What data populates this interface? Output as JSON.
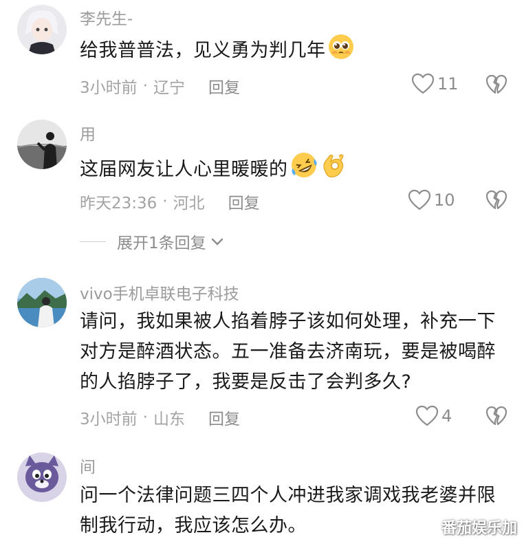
{
  "comments": [
    {
      "username": "李先生-",
      "text": "给我普普法，见义勇为判几年",
      "emoji": [
        "pleading-face-icon"
      ],
      "time": "3小时前",
      "separator": "·",
      "location": "辽宁",
      "reply_label": "回复",
      "likes": "11",
      "avatar": "anime-girl-avatar"
    },
    {
      "username": "用",
      "text": "这届网友让人心里暖暖的",
      "emoji": [
        "rolling-laughing-icon",
        "ok-hand-icon"
      ],
      "time": "昨天23:36",
      "separator": "·",
      "location": "河北",
      "reply_label": "回复",
      "likes": "10",
      "avatar": "silhouette-sunset-avatar"
    },
    {
      "username": "vivo手机卓联电子科技",
      "text": "请问，我如果被人掐着脖子该如何处理，补充一下对方是醉酒状态。五一准备去济南玩，要是被喝醉的人掐脖子了，我要是反击了会判多久?",
      "time": "3小时前",
      "separator": "·",
      "location": "山东",
      "reply_label": "回复",
      "likes": "4",
      "avatar": "person-lake-avatar"
    },
    {
      "username": "间",
      "text": "问一个法律问题三四个人冲进我家调戏我老婆并限制我行动，我应该怎么办。",
      "avatar": "cartoon-cat-avatar"
    }
  ],
  "expand_replies": "展开1条回复",
  "watermark": "番茄娱乐加",
  "colors": {
    "meta": "#a3a3a3",
    "text": "#1a1a1a",
    "username": "#9b9b9b"
  }
}
